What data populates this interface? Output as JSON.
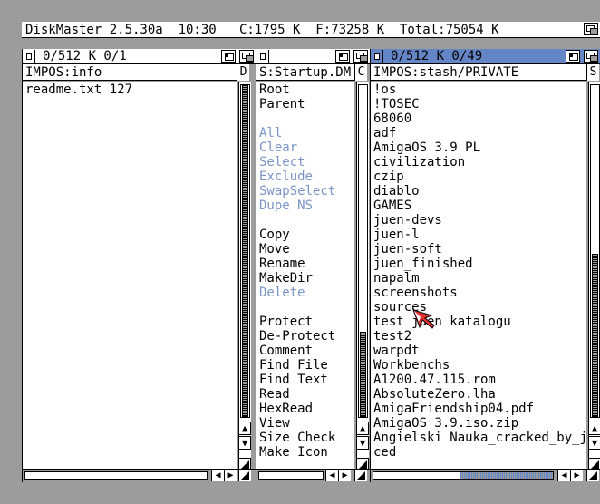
{
  "screen": {
    "title": "DiskMaster 2.5.30a  10:30   C:1795 K  F:73258 K  Total:75054 K"
  },
  "windows": {
    "left": {
      "status": "0/512 K 0/1",
      "path": "IMPOS:info",
      "sort_label": "D",
      "items": [
        "readme.txt 127"
      ]
    },
    "middle": {
      "status": "",
      "path": "S:Startup.DM",
      "sort_label": "C",
      "commands": [
        {
          "label": "Root",
          "enabled": true
        },
        {
          "label": "Parent",
          "enabled": true
        },
        {
          "label": "",
          "enabled": true
        },
        {
          "label": "All",
          "enabled": false
        },
        {
          "label": "Clear",
          "enabled": false
        },
        {
          "label": "Select",
          "enabled": false
        },
        {
          "label": "Exclude",
          "enabled": false
        },
        {
          "label": "SwapSelect",
          "enabled": false
        },
        {
          "label": "Dupe NS",
          "enabled": false
        },
        {
          "label": "",
          "enabled": true
        },
        {
          "label": "Copy",
          "enabled": true
        },
        {
          "label": "Move",
          "enabled": true
        },
        {
          "label": "Rename",
          "enabled": true
        },
        {
          "label": "MakeDir",
          "enabled": true
        },
        {
          "label": "Delete",
          "enabled": false
        },
        {
          "label": "",
          "enabled": true
        },
        {
          "label": "Protect",
          "enabled": true
        },
        {
          "label": "De-Protect",
          "enabled": true
        },
        {
          "label": "Comment",
          "enabled": true
        },
        {
          "label": "Find File",
          "enabled": true
        },
        {
          "label": "Find Text",
          "enabled": true
        },
        {
          "label": "Read",
          "enabled": true
        },
        {
          "label": "HexRead",
          "enabled": true
        },
        {
          "label": "View",
          "enabled": true
        },
        {
          "label": "Size Check",
          "enabled": true
        },
        {
          "label": "Make Icon",
          "enabled": true
        }
      ]
    },
    "right": {
      "status": "0/512 K 0/49",
      "path": "IMPOS:stash/PRIVATE",
      "sort_label": "S",
      "items": [
        "!os",
        "!TOSEC",
        "68060",
        "adf",
        "AmigaOS 3.9 PL",
        "civilization",
        "czip",
        "diablo",
        "GAMES",
        "juen-devs",
        "juen-l",
        "juen-soft",
        "juen_finished",
        "napalm",
        "screenshots",
        "sources",
        "test juen katalogu",
        "test2",
        "warpdt",
        "Workbenchs",
        "A1200.47.115.rom",
        "AbsoluteZero.lha",
        "AmigaFriendship04.pdf",
        "AmigaOS 3.9.iso.zip",
        "Angielski Nauka_cracked_by_ju",
        "ced"
      ]
    }
  },
  "icons": {
    "up": "▲",
    "down": "▼",
    "left": "◀",
    "right": "▶"
  },
  "colors": {
    "background": "#9c9c9c",
    "active_title": "#6586c6",
    "disabled_text": "#7a94c8"
  }
}
